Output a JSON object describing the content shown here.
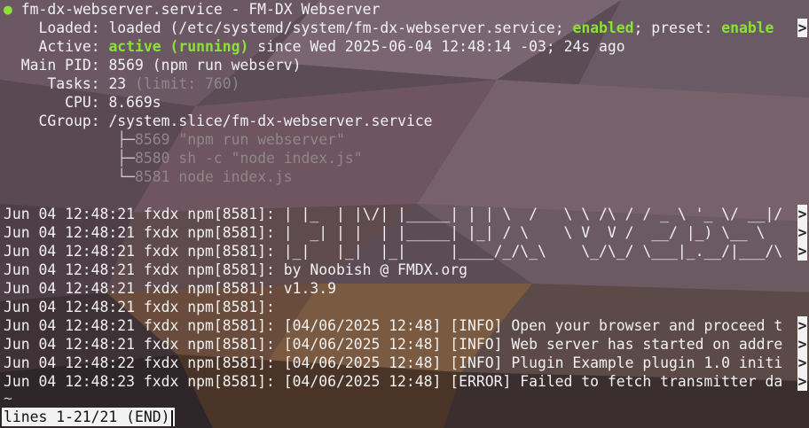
{
  "colors": {
    "active_green": "#8ae234",
    "dim_text": "#8f8788",
    "text": "#f2f2f2",
    "status_bg": "#f2f2f2"
  },
  "header": {
    "dot": "●",
    "title": "fm-dx-webserver.service - FM-DX Webserver"
  },
  "status_fields": {
    "loaded_label": "Loaded:",
    "loaded_value_a": "loaded (/etc/systemd/system/fm-dx-webserver.service; ",
    "loaded_enabled": "enabled",
    "loaded_value_b": "; preset: ",
    "loaded_preset": "enable",
    "active_label": "Active:",
    "active_value": "active (running)",
    "active_since": " since Wed 2025-06-04 12:48:14 -03; 24s ago",
    "pid_label": "Main PID:",
    "pid_value": "8569 (npm run webserv)",
    "tasks_label": "Tasks:",
    "tasks_value": "23",
    "tasks_limit": " (limit: 760)",
    "cpu_label": "CPU:",
    "cpu_value": "8.669s",
    "cgroup_label": "CGroup:",
    "cgroup_value": "/system.slice/fm-dx-webserver.service"
  },
  "cgroup_tree": [
    {
      "branch": "├─",
      "text": "8569 \"npm run webserver\""
    },
    {
      "branch": "├─",
      "text": "8580 sh -c \"node index.js\""
    },
    {
      "branch": "└─",
      "text": "8581 node index.js"
    }
  ],
  "journal": [
    "Jun 04 12:48:21 fxdx npm[8581]: | |_  | |\\/| |_____| | | \\  /   \\ \\ /\\ / / _ \\ '_ \\/ __|/",
    "Jun 04 12:48:21 fxdx npm[8581]: |  _| | |  | |_____| |_| / \\    \\ V  V /  __/ |_) \\__ \\",
    "Jun 04 12:48:21 fxdx npm[8581]: |_|   |_|  |_|     |____/_/\\_\\    \\_/\\_/ \\___|_.__/|___/\\",
    "Jun 04 12:48:21 fxdx npm[8581]: by Noobish @ FMDX.org",
    "Jun 04 12:48:21 fxdx npm[8581]: v1.3.9",
    "Jun 04 12:48:21 fxdx npm[8581]:",
    "Jun 04 12:48:21 fxdx npm[8581]: [04/06/2025 12:48] [INFO] Open your browser and proceed t",
    "Jun 04 12:48:21 fxdx npm[8581]: [04/06/2025 12:48] [INFO] Web server has started on addre",
    "Jun 04 12:48:22 fxdx npm[8581]: [04/06/2025 12:48] [INFO] Plugin Example plugin 1.0 initi",
    "Jun 04 12:48:23 fxdx npm[8581]: [04/06/2025 12:48] [ERROR] Failed to fetch transmitter da"
  ],
  "truncation_marker": ">",
  "tilde": "~",
  "pager_status": "lines 1-21/21 (END)"
}
